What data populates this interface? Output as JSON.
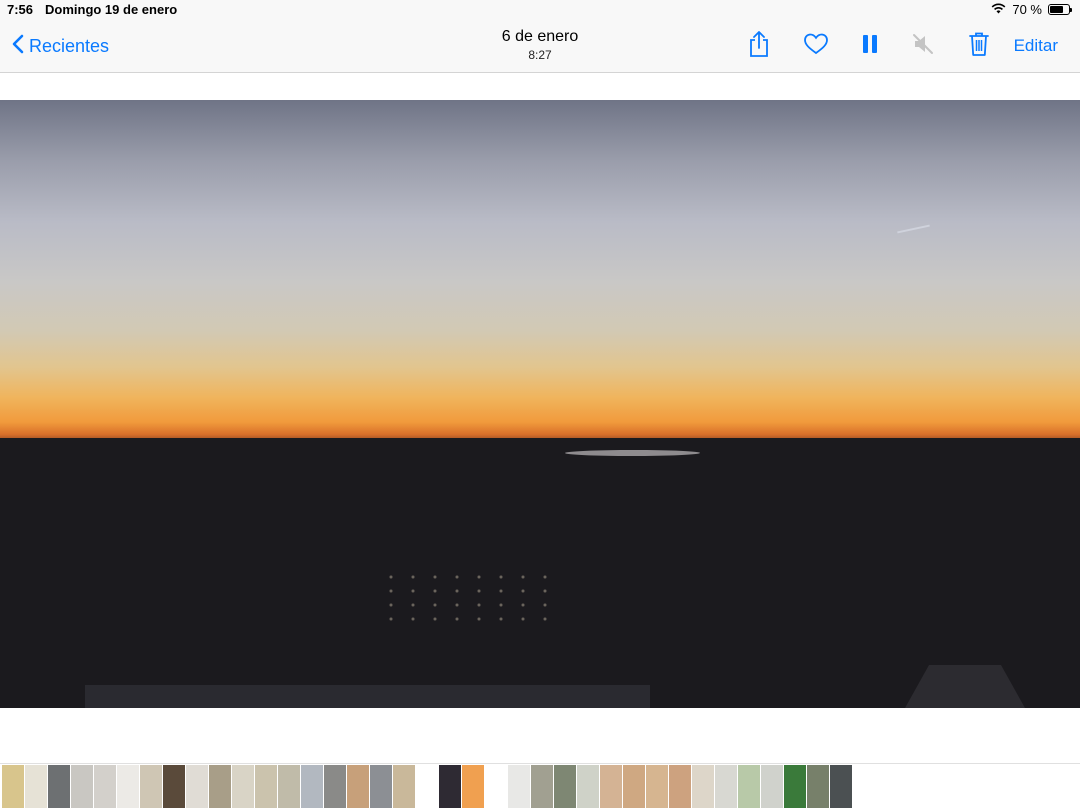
{
  "status_bar": {
    "time": "7:56",
    "date": "Domingo 19 de enero",
    "battery_text": "70 %",
    "battery_level": 0.7
  },
  "nav": {
    "back_label": "Recientes",
    "title": "6 de enero",
    "subtitle": "8:27",
    "edit_label": "Editar",
    "accent_color": "#0a7aff",
    "icons": [
      "share-icon",
      "heart-icon",
      "pause-icon",
      "mute-icon",
      "trash-icon"
    ]
  },
  "thumbnails": {
    "colors": [
      "#d8c58c",
      "#e6e2d6",
      "#6d7072",
      "#c9c7c2",
      "#d3d0cb",
      "#eceae6",
      "#cfc6b4",
      "#5a4a3a",
      "#e0dcd5",
      "#a89e88",
      "#d9d4c6",
      "#cbc3ad",
      "#c0bba9",
      "#b2b8c0",
      "#8a8a88",
      "#c7a07a",
      "#8c8f94",
      "#c9b89a",
      "#ffffff",
      "#2e2a33",
      "#f0a050",
      "#ffffff",
      "#e8e8e6",
      "#a1a091",
      "#7e8773",
      "#cfd2c8",
      "#d4b394",
      "#cfa882",
      "#d6b590",
      "#cda27f",
      "#ddd6c9",
      "#d8d8d2",
      "#b8c9a8",
      "#d0d2cc",
      "#3a7a3a",
      "#77806a",
      "#4b5052"
    ]
  }
}
